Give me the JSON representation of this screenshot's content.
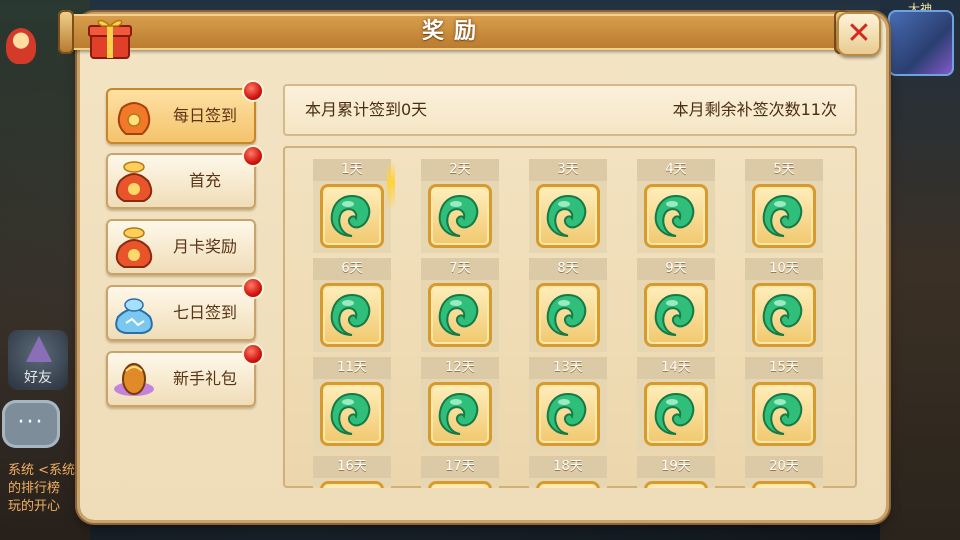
{
  "background": {
    "hero_name": "大神",
    "friends_label": "好友",
    "chat_lines": [
      "系统 <系统",
      "的排行榜",
      "玩的开心"
    ]
  },
  "dialog": {
    "title": "奖励",
    "close_label": "✕"
  },
  "sidebar": {
    "items": [
      {
        "label": "每日签到",
        "icon": "lucky-bag-icon",
        "active": true,
        "has_notice": true
      },
      {
        "label": "首充",
        "icon": "money-bag-icon",
        "active": false,
        "has_notice": true
      },
      {
        "label": "月卡奖励",
        "icon": "money-bag-icon",
        "active": false,
        "has_notice": false
      },
      {
        "label": "七日签到",
        "icon": "crystal-bag-icon",
        "active": false,
        "has_notice": true
      },
      {
        "label": "新手礼包",
        "icon": "gift-egg-icon",
        "active": false,
        "has_notice": true
      }
    ]
  },
  "info": {
    "signed_days": "本月累计签到0天",
    "remaining_makeups": "本月剩余补签次数11次"
  },
  "days": [
    {
      "label": "1天",
      "reward": "jade-icon"
    },
    {
      "label": "2天",
      "reward": "jade-icon"
    },
    {
      "label": "3天",
      "reward": "jade-icon"
    },
    {
      "label": "4天",
      "reward": "jade-icon"
    },
    {
      "label": "5天",
      "reward": "jade-icon"
    },
    {
      "label": "6天",
      "reward": "jade-icon"
    },
    {
      "label": "7天",
      "reward": "jade-icon"
    },
    {
      "label": "8天",
      "reward": "jade-icon"
    },
    {
      "label": "9天",
      "reward": "jade-icon"
    },
    {
      "label": "10天",
      "reward": "jade-icon"
    },
    {
      "label": "11天",
      "reward": "jade-icon"
    },
    {
      "label": "12天",
      "reward": "jade-icon"
    },
    {
      "label": "13天",
      "reward": "jade-icon"
    },
    {
      "label": "14天",
      "reward": "jade-icon"
    },
    {
      "label": "15天",
      "reward": "jade-icon"
    },
    {
      "label": "16天",
      "reward": "jade-icon"
    },
    {
      "label": "17天",
      "reward": "jade-icon"
    },
    {
      "label": "18天",
      "reward": "jade-icon"
    },
    {
      "label": "19天",
      "reward": "jade-icon"
    },
    {
      "label": "20天",
      "reward": "jade-icon"
    }
  ],
  "colors": {
    "active_tab": "#f3c26a",
    "notice_dot": "#d0150e",
    "jade": "#2fbf7a",
    "tile_border": "#d59a30"
  }
}
